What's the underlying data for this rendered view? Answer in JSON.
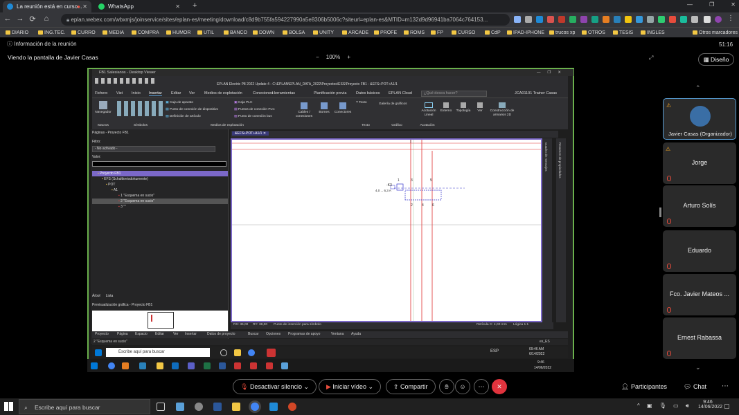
{
  "browser": {
    "tabs": [
      {
        "title": "La reunión está en curso..."
      },
      {
        "title": "WhatsApp"
      }
    ],
    "url": "eplan.webex.com/wbxmjs/joinservice/sites/eplan-es/meeting/download/c8d9b755fa594227990a5e8306b5006c?siteurl=eplan-es&MTID=m132d9d96941ba7064c764153...",
    "bookmarks": [
      "DIARIO",
      "ING.TEC.",
      "CURRO",
      "MEDIA",
      "COMPRA",
      "HUMOR",
      "UTIL",
      "BANCO",
      "DOWN",
      "BOLSA",
      "UNITY",
      "ARCADE",
      "PROFE",
      "ROMS",
      "FP",
      "CURSO",
      "CdP",
      "IPAD-IPHONE",
      "trucos xp",
      "OTROS",
      "TESIS",
      "INGLES"
    ],
    "other_bookmarks": "Otros marcadores"
  },
  "meeting": {
    "info_label": "Información de la reunión",
    "timer": "51:16",
    "viewing": "Viendo la pantalla de Javier Casas",
    "zoom": "100%",
    "design_button": "Diseño"
  },
  "eplan": {
    "window_title": "FB1 Salesianos - Desktop Viewer",
    "app_title": "EPLAN Electric P8 2022 Update 4 - C:\\EPLAN\\EPLAN_DATA_2022\\Proyectos\\ESS\\Proyecto FB1 - &EFS+POT+A1/1",
    "menu_tabs": [
      "Fichero",
      "Vist",
      "Inicio",
      "Insertar",
      "Editar",
      "Ver",
      "Medios de explotación",
      "Conexiones",
      "Herramientas",
      "Planificación previa",
      "Datos básicos",
      "EPLAN Cloud"
    ],
    "search_placeholder": "¿Qué desea hacer?",
    "user": "JCA01101 Trainer Casas",
    "ribbon": {
      "navegador": "Navegador",
      "macros": "Macros",
      "simbolos": "Símbolos",
      "caja_aparato": "Caja de aparato",
      "punto_conexion_dispositivo": "Punto de conexión de dispositivo",
      "definicion_articulo": "Definición de artículo",
      "caja_plc": "Caja PLC",
      "puntos_conexion_plc": "Puntos de conexión PLC",
      "punto_conexion_bus": "Punto de conexión bus",
      "medios_group": "Medios de explotación",
      "cables": "Cables / conexiones",
      "bornes": "Bornes",
      "conectores": "Conectores",
      "texto_btn": "Texto",
      "texto_group": "Texto",
      "galeria": "Galería de gráficos",
      "grafico_group": "Gráfico",
      "acotacion_lineal": "Acotación Lineal",
      "externo": "Externo",
      "topologia": "Topología",
      "ver": "Ver",
      "construccion": "Construcción de armarios 2D",
      "acotacion_group": "Acotación"
    },
    "pages_panel": {
      "title": "Páginas - Proyecto FB1",
      "filter_label": "Filtro:",
      "filter_value": "- No activado -",
      "value_label": "Valor:",
      "tree": [
        "Proyecto FB1",
        "EFS (Schaltkreisdokumente)",
        "POT",
        "A1",
        "1 \"Esquema en sucio\"",
        "2 \"Esquema en sucio\"",
        "3 \"\""
      ],
      "tabs": [
        "Árbol",
        "Lista"
      ]
    },
    "preview_title": "Previsualización gráfica - Proyecto FB1",
    "doc_tab": "&EFS+POT+A1/1",
    "right_strip": [
      "Resumen de propiedades",
      "Cuadro de mensajes"
    ],
    "drawing_labels": {
      "ref": "-K3",
      "range": "4,0 ... 6,3 A"
    },
    "status": {
      "rx": "RX: 36,00",
      "ry": "RY: 38,00",
      "hint": "Punto de inserción para símbolo",
      "grid": "Retícula C: 4,00 mm",
      "logic": "Lógica 1:1"
    },
    "bottom_menu": [
      "Proyecto",
      "Página",
      "Espacio",
      "Editar",
      "Ver",
      "Insertar",
      "Datos de proyecto",
      "Buscar",
      "Opciones",
      "Programas de apoyo",
      "Ventana",
      "Ayuda"
    ],
    "bottom_status": "2 \"Esquema en sucio\"",
    "bottom_lang": "es_ES",
    "inner_search": "Escribe aquí para buscar",
    "inner_time": "09:46 AM",
    "inner_date": "6/14/2022",
    "inner_lang": "ESP",
    "outer2_time": "9:46",
    "outer2_date": "14/06/2022"
  },
  "participants": [
    {
      "name": "Javier Casas (Organizador)"
    },
    {
      "name": "Jorge"
    },
    {
      "name": "Arturo Solís"
    },
    {
      "name": "Eduardo"
    },
    {
      "name": "Fco. Javier Mateos ..."
    },
    {
      "name": "Ernest Rabassa"
    }
  ],
  "controls": {
    "mute": "Desactivar silencio",
    "video": "Iniciar vídeo",
    "share": "Compartir",
    "participants": "Participantes",
    "chat": "Chat"
  },
  "taskbar": {
    "search": "Escribe aquí para buscar",
    "time": "9:46",
    "date": "14/06/2022"
  },
  "colors": {
    "accent_green": "#6ab04c",
    "red_button": "#e0333d",
    "eplan_selection": "#7b68c8",
    "wire_red": "#e03030"
  }
}
